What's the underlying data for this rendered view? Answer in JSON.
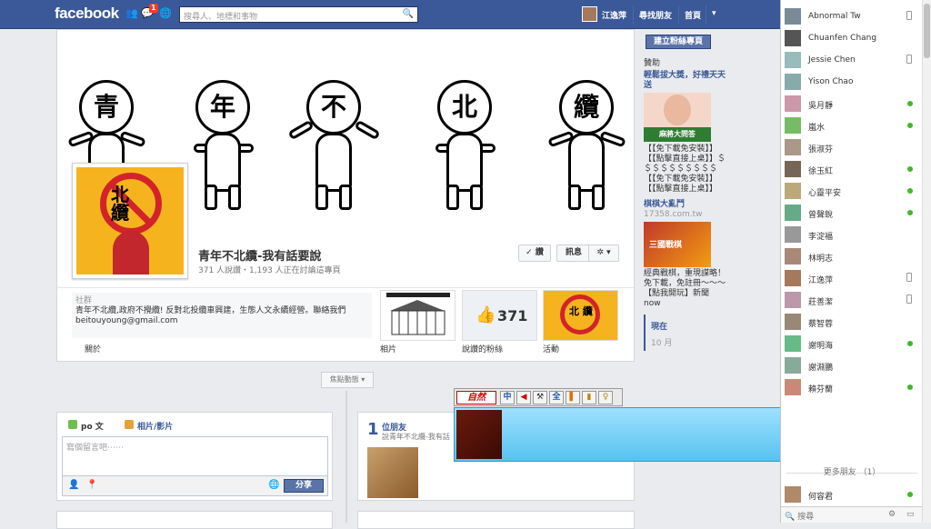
{
  "topbar": {
    "logo": "facebook",
    "notification_count": "1",
    "search_placeholder": "搜尋人、地標和事物",
    "user_name": "江逸萍",
    "find_friends": "尋找朋友",
    "home": "首頁"
  },
  "cover": {
    "characters": [
      "青",
      "年",
      "不",
      "北",
      "纜"
    ]
  },
  "profile": {
    "badge_text": "北\n纜",
    "name": "青年不北纜-我有話要說",
    "stats": "371 人說讚・1,193 人正在討論這專頁",
    "like_button": "✓ 讚",
    "message_button": "訊息",
    "gear_button": "✲ ▾"
  },
  "about": {
    "heading": "社群",
    "line1": "青年不北纜,政府不攪纜! 反對北投纜車興建，生態人文永續經營。聯絡我們",
    "line2": "beitouyoung@gmail.com",
    "label": "關於"
  },
  "apps": {
    "photos_label": "相片",
    "likes_count": "371",
    "likes_label": "說讚的粉絲",
    "events_label": "活動"
  },
  "timeline": {
    "highlights_button": "焦點動態 ▾"
  },
  "composer": {
    "tab_post": "po 文",
    "tab_photo": "相片/影片",
    "placeholder": "寫個留言吧⋯⋯",
    "share_button": "分享"
  },
  "friends_box": {
    "count": "1",
    "title": "位朋友",
    "sub": "說青年不北纜-我有話"
  },
  "rail": {
    "create_button": "建立粉絲專頁",
    "sponsored": "贊助",
    "ad1_title": "輕鬆拔大獎，好禮天天送",
    "ad1_img_text": "麻將大問答",
    "ad1_text": "【【免下載免安裝】】【【點擊直接上桌】】＄＄＄＄＄＄＄＄＄＄【【免下載免安裝】】【【點擊直接上桌】】",
    "ad2_title": "棋棋大亂鬥",
    "ad2_url": "17358.com.tw",
    "ad2_img_text": "三國戰棋",
    "ad2_text": "經典戰棋，重現謀略！免下載，免註冊～～～【點我開玩】新聞now",
    "now": "現在",
    "month": "10 月"
  },
  "ime": {
    "logo": "自然",
    "buttons": [
      "中",
      "◀",
      "⚒",
      "全",
      "▌",
      "▮",
      "♀"
    ]
  },
  "chat": {
    "contacts": [
      {
        "name": "Abnormal Tw",
        "status": "mobile"
      },
      {
        "name": "Chuanfen Chang",
        "status": "none"
      },
      {
        "name": "Jessie Chen",
        "status": "mobile"
      },
      {
        "name": "Yison Chao",
        "status": "none"
      },
      {
        "name": "吳月靜",
        "status": "online"
      },
      {
        "name": "嵐水",
        "status": "online"
      },
      {
        "name": "張淑芬",
        "status": "none"
      },
      {
        "name": "徐玉紅",
        "status": "online"
      },
      {
        "name": "心靈平安",
        "status": "online"
      },
      {
        "name": "曾聲銳",
        "status": "online"
      },
      {
        "name": "李淀福",
        "status": "none"
      },
      {
        "name": "林明志",
        "status": "none"
      },
      {
        "name": "江逸萍",
        "status": "mobile"
      },
      {
        "name": "莊善潔",
        "status": "mobile"
      },
      {
        "name": "蔡智蓉",
        "status": "none"
      },
      {
        "name": "謝明海",
        "status": "online"
      },
      {
        "name": "謝淵鵬",
        "status": "none"
      },
      {
        "name": "賴芬蘭",
        "status": "online"
      }
    ],
    "more_friends": "更多朋友 （1）",
    "more_contact": "何容君",
    "search": "搜尋"
  },
  "colors": {
    "brand": "#3b5998",
    "online": "#42b72a",
    "badge": "#f03d25"
  }
}
